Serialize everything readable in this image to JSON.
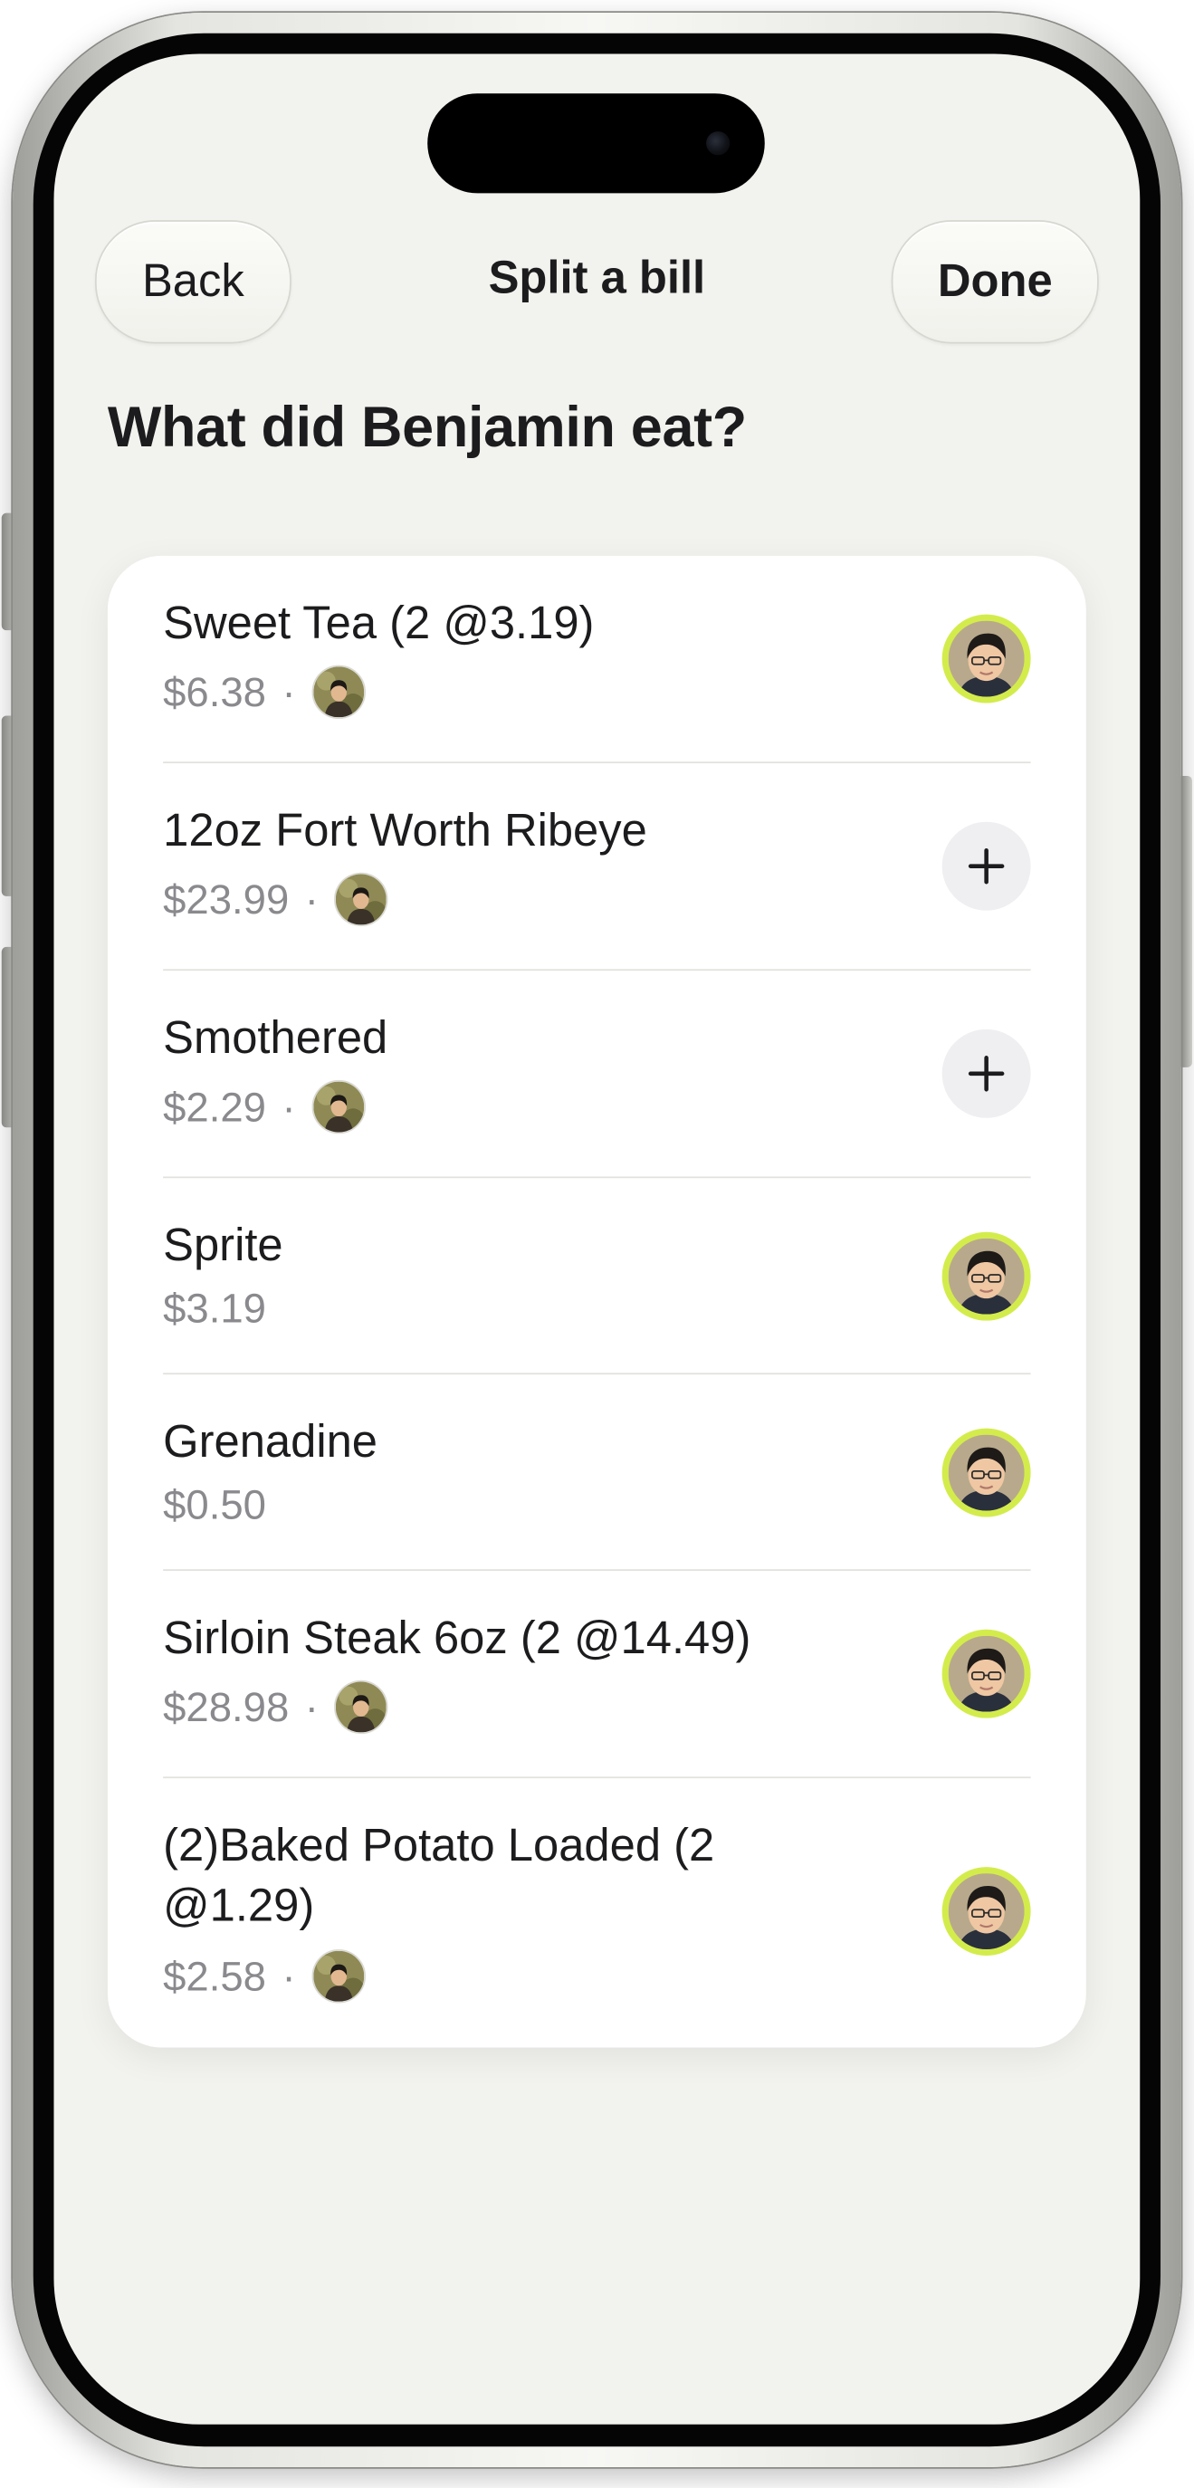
{
  "nav": {
    "back_label": "Back",
    "title": "Split a bill",
    "done_label": "Done"
  },
  "question": "What did Benjamin eat?",
  "colors": {
    "screen_background": "#f2f2ee",
    "card_background": "#ffffff",
    "selected_ring": "#d3ec4c",
    "add_button_background": "#efeff1",
    "secondary_text": "#8a8a8e"
  },
  "items": [
    {
      "name": "Sweet Tea (2 @3.19)",
      "price": "$6.38",
      "separator": "·",
      "shared_with": "mini-avatar",
      "control": "benjamin-avatar-selected"
    },
    {
      "name": "12oz Fort Worth Ribeye",
      "price": "$23.99",
      "separator": "·",
      "shared_with": "mini-avatar",
      "control": "plus-icon"
    },
    {
      "name": "Smothered",
      "price": "$2.29",
      "separator": "·",
      "shared_with": "mini-avatar",
      "control": "plus-icon"
    },
    {
      "name": "Sprite",
      "price": "$3.19",
      "separator": "",
      "shared_with": "",
      "control": "benjamin-avatar-selected"
    },
    {
      "name": "Grenadine",
      "price": "$0.50",
      "separator": "",
      "shared_with": "",
      "control": "benjamin-avatar-selected"
    },
    {
      "name": "Sirloin Steak 6oz (2 @14.49)",
      "price": "$28.98",
      "separator": "·",
      "shared_with": "mini-avatar",
      "control": "benjamin-avatar-selected"
    },
    {
      "name": "(2)Baked Potato Loaded (2 @1.29)",
      "price": "$2.58",
      "separator": "·",
      "shared_with": "mini-avatar",
      "control": "benjamin-avatar-selected"
    }
  ]
}
